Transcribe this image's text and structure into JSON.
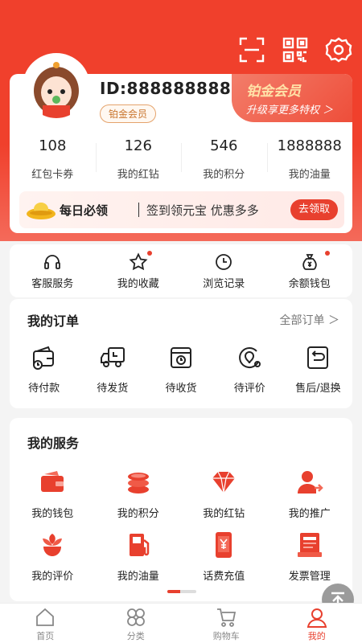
{
  "colors": {
    "brand": "#f0402c",
    "accent": "#e8402e",
    "gold": "#c9752e"
  },
  "header": {
    "icons": [
      "scan-icon",
      "qrcode-icon",
      "settings-icon"
    ]
  },
  "profile": {
    "id_text": "ID:888888888",
    "level": "铂金会员"
  },
  "vip": {
    "title": "铂金会员",
    "subtitle": "升级享更多特权 ＞"
  },
  "stats": [
    {
      "value": "108",
      "label": "红包卡券"
    },
    {
      "value": "126",
      "label": "我的红钻"
    },
    {
      "value": "546",
      "label": "我的积分"
    },
    {
      "value": "1888888",
      "label": "我的油量"
    }
  ],
  "daily": {
    "title": "每日必领",
    "desc": "签到领元宝  优惠多多",
    "button": "去领取"
  },
  "quick": [
    {
      "label": "客服服务",
      "icon": "headset-icon",
      "dot": false
    },
    {
      "label": "我的收藏",
      "icon": "star-icon",
      "dot": true
    },
    {
      "label": "浏览记录",
      "icon": "clock-icon",
      "dot": false
    },
    {
      "label": "余额钱包",
      "icon": "money-bag-icon",
      "dot": true
    }
  ],
  "orders": {
    "title": "我的订单",
    "all": "全部订单 ＞",
    "items": [
      {
        "label": "待付款",
        "icon": "wallet-icon"
      },
      {
        "label": "待发货",
        "icon": "truck-icon"
      },
      {
        "label": "待收货",
        "icon": "package-icon"
      },
      {
        "label": "待评价",
        "icon": "review-icon"
      },
      {
        "label": "售后/退换",
        "icon": "return-icon"
      }
    ]
  },
  "services": {
    "title": "我的服务",
    "items": [
      {
        "label": "我的钱包",
        "icon": "wallet-icon"
      },
      {
        "label": "我的积分",
        "icon": "coins-icon"
      },
      {
        "label": "我的红钻",
        "icon": "diamond-icon"
      },
      {
        "label": "我的推广",
        "icon": "promote-icon"
      },
      {
        "label": "我的评价",
        "icon": "flower-icon"
      },
      {
        "label": "我的油量",
        "icon": "fuel-icon"
      },
      {
        "label": "话费充值",
        "icon": "phone-recharge-icon"
      },
      {
        "label": "发票管理",
        "icon": "invoice-icon"
      }
    ]
  },
  "tabs": [
    {
      "label": "首页",
      "icon": "home-icon",
      "active": false
    },
    {
      "label": "分类",
      "icon": "category-icon",
      "active": false
    },
    {
      "label": "购物车",
      "icon": "cart-icon",
      "active": false
    },
    {
      "label": "我的",
      "icon": "user-icon",
      "active": true
    }
  ]
}
